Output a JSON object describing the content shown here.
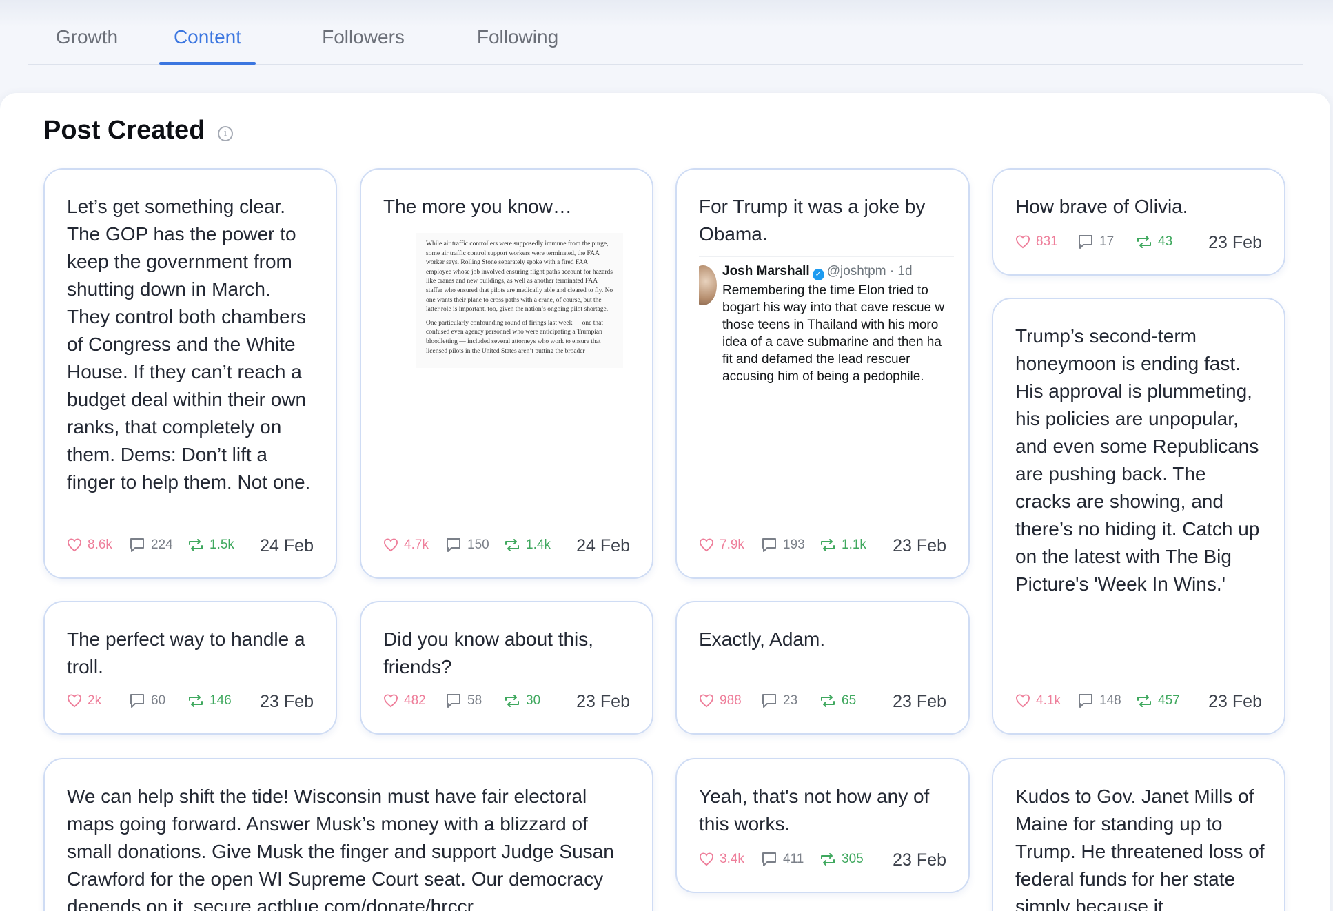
{
  "tabs": [
    {
      "label": "Growth",
      "active": false
    },
    {
      "label": "Content",
      "active": true
    },
    {
      "label": "Followers",
      "active": false
    },
    {
      "label": "Following",
      "active": false
    }
  ],
  "section": {
    "title": "Post Created",
    "info_icon": "info-icon"
  },
  "colors": {
    "accent": "#3b76e0",
    "likes": "#ee7e9a",
    "reposts": "#3fa85e",
    "card_border": "#cfdcf4"
  },
  "posts": [
    {
      "text": "Let’s get something clear. The GOP has the power to keep the government from shutting down in March. They control both chambers of Congress and the White House. If they can’t reach a budget deal within their own ranks, that completely on them. Dems: Don’t lift a finger to help them. Not one.",
      "likes": "8.6k",
      "replies": "224",
      "reposts": "1.5k",
      "date": "24 Feb"
    },
    {
      "text": "The more you know…",
      "attachment": {
        "type": "news-clipping",
        "paragraph1": "While air traffic controllers were supposedly immune from the purge, some air traffic control support workers were terminated, the FAA worker says. Rolling Stone separately spoke with a fired FAA employee whose job involved ensuring flight paths account for hazards like cranes and new buildings, as well as another terminated FAA staffer who ensured that pilots are medically able and cleared to fly. No one wants their plane to cross paths with a crane, of course, but the latter role is important, too, given the nation’s ongoing pilot shortage.",
        "paragraph2": "One particularly confounding round of firings last week — one that confused even agency personnel who were anticipating a Trumpian bloodletting — included several attorneys who work to ensure that licensed pilots in the United States aren’t putting the broader"
      },
      "likes": "4.7k",
      "replies": "150",
      "reposts": "1.4k",
      "date": "24 Feb"
    },
    {
      "text": "For Trump it was a joke by Obama.",
      "embed": {
        "name": "Josh Marshall",
        "handle": "@joshtpm · 1d",
        "body": "Remembering the time Elon tried to\nbogart his way into that cave rescue w\nthose teens in Thailand with his moro\nidea of a cave submarine and then ha\nfit and defamed the lead rescuer\naccusing him of being a pedophile."
      },
      "likes": "7.9k",
      "replies": "193",
      "reposts": "1.1k",
      "date": "23 Feb"
    },
    {
      "text": "How brave of Olivia.",
      "likes": "831",
      "replies": "17",
      "reposts": "43",
      "date": "23 Feb"
    },
    {
      "text": "Trump’s second-term honeymoon is ending fast. His approval is plummeting, his policies are unpopular, and even some Republicans are pushing back. The cracks are showing, and there’s no hiding it. Catch up on the latest with The Big Picture's 'Week In Wins.'",
      "likes": "4.1k",
      "replies": "148",
      "reposts": "457",
      "date": "23 Feb"
    },
    {
      "text": "The perfect way to handle a troll.",
      "likes": "2k",
      "replies": "60",
      "reposts": "146",
      "date": "23 Feb"
    },
    {
      "text": "Did you know about this, friends?",
      "likes": "482",
      "replies": "58",
      "reposts": "30",
      "date": "23 Feb"
    },
    {
      "text": "Exactly, Adam.",
      "likes": "988",
      "replies": "23",
      "reposts": "65",
      "date": "23 Feb"
    },
    {
      "text": "We can help shift the tide! Wisconsin must have fair electoral maps going forward. Answer Musk’s money with a blizzard of small donations. Give Musk the finger and support Judge Susan Crawford for the open WI Supreme Court seat. Our democracy depends on it. secure.actblue.com/donate/hrccr…"
    },
    {
      "text": "Yeah, that's not how any of this works.",
      "likes": "3.4k",
      "replies": "411",
      "reposts": "305",
      "date": "23 Feb"
    },
    {
      "text": "Kudos to Gov. Janet Mills of Maine for standing up to Trump. He threatened loss of federal funds for her state simply because it"
    }
  ]
}
